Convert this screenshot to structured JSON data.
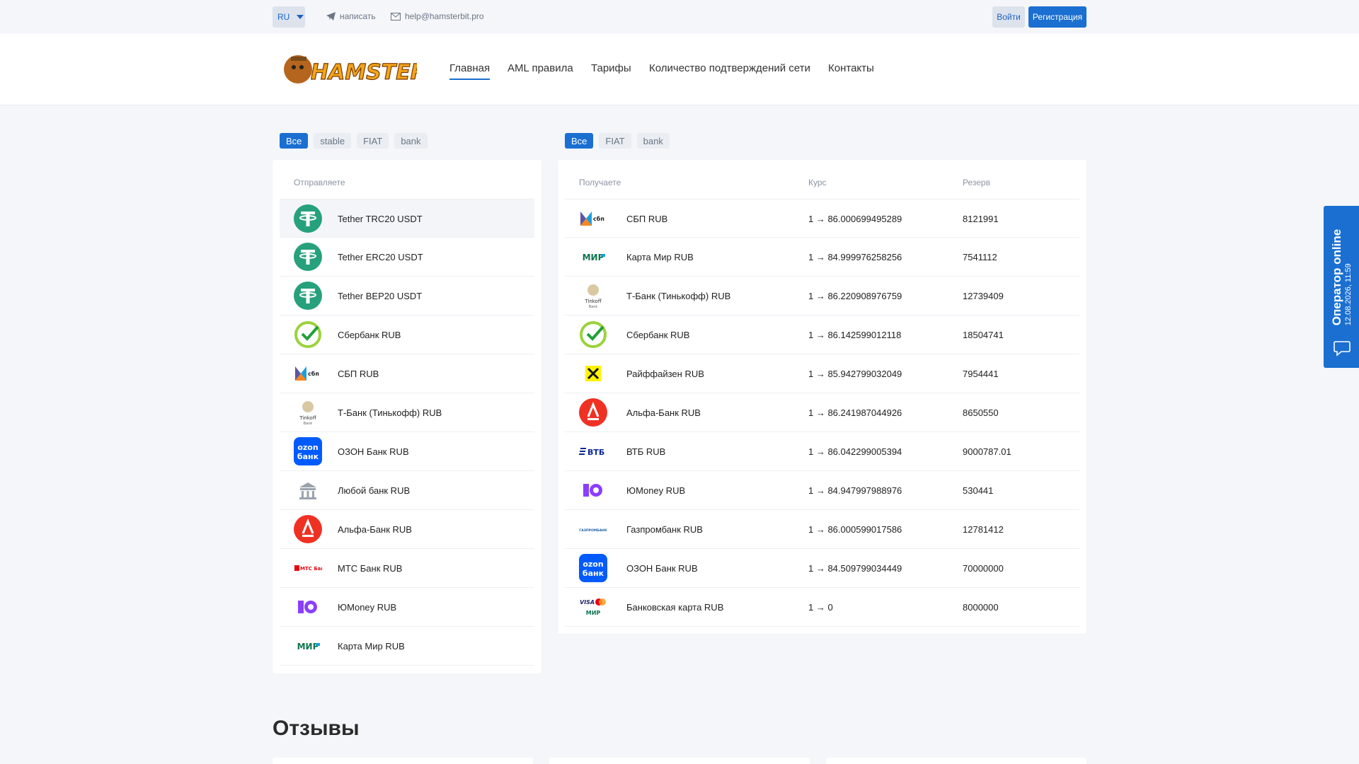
{
  "topbar": {
    "lang": "RU",
    "write_label": "написать",
    "email": "help@hamsterbit.pro",
    "login": "Войти",
    "register": "Регистрация"
  },
  "logo_text": "HAMSTERBIT",
  "nav": [
    "Главная",
    "AML правила",
    "Тарифы",
    "Количество подтверждений сети",
    "Контакты"
  ],
  "send_filters": [
    "Все",
    "stable",
    "FIAT",
    "bank"
  ],
  "receive_filters": [
    "Все",
    "FIAT",
    "bank"
  ],
  "send": {
    "header": "Отправляете",
    "items": [
      {
        "name": "Tether TRC20 USDT",
        "icon": "tether-icon"
      },
      {
        "name": "Tether ERC20 USDT",
        "icon": "tether-icon"
      },
      {
        "name": "Tether BEP20 USDT",
        "icon": "tether-icon"
      },
      {
        "name": "Сбербанк RUB",
        "icon": "sber-icon"
      },
      {
        "name": "СБП RUB",
        "icon": "sbp-icon"
      },
      {
        "name": "Т-Банк (Тинькофф) RUB",
        "icon": "tinkoff-icon"
      },
      {
        "name": "ОЗОН Банк RUB",
        "icon": "ozon-icon"
      },
      {
        "name": "Любой банк RUB",
        "icon": "bank-building-icon"
      },
      {
        "name": "Альфа-Банк RUB",
        "icon": "alfa-icon"
      },
      {
        "name": "МТС Банк RUB",
        "icon": "mts-icon"
      },
      {
        "name": "ЮMoney RUB",
        "icon": "yoomoney-icon"
      },
      {
        "name": "Карта Мир RUB",
        "icon": "mir-icon"
      }
    ]
  },
  "receive": {
    "headers": {
      "name": "Получаете",
      "rate": "Курс",
      "reserve": "Резерв"
    },
    "items": [
      {
        "name": "СБП RUB",
        "rate": "1 → 86.000699495289",
        "reserve": "8121991",
        "icon": "sbp-icon"
      },
      {
        "name": "Карта Мир RUB",
        "rate": "1 → 84.999976258256",
        "reserve": "7541112",
        "icon": "mir-icon"
      },
      {
        "name": "Т-Банк (Тинькофф) RUB",
        "rate": "1 → 86.220908976759",
        "reserve": "12739409",
        "icon": "tinkoff-icon"
      },
      {
        "name": "Сбербанк RUB",
        "rate": "1 → 86.142599012118",
        "reserve": "18504741",
        "icon": "sber-icon"
      },
      {
        "name": "Райффайзен RUB",
        "rate": "1 → 85.942799032049",
        "reserve": "7954441",
        "icon": "raiffeisen-icon"
      },
      {
        "name": "Альфа-Банк RUB",
        "rate": "1 → 86.241987044926",
        "reserve": "8650550",
        "icon": "alfa-icon"
      },
      {
        "name": "ВТБ RUB",
        "rate": "1 → 86.042299005394",
        "reserve": "9000787.01",
        "icon": "vtb-icon"
      },
      {
        "name": "ЮMoney RUB",
        "rate": "1 → 84.947997988976",
        "reserve": "530441",
        "icon": "yoomoney-icon"
      },
      {
        "name": "Газпромбанк RUB",
        "rate": "1 → 86.000599017586",
        "reserve": "12781412",
        "icon": "gazprom-icon"
      },
      {
        "name": "ОЗОН Банк RUB",
        "rate": "1 → 84.509799034449",
        "reserve": "70000000",
        "icon": "ozon-icon"
      },
      {
        "name": "Банковская карта RUB",
        "rate": "1 → 0",
        "reserve": "8000000",
        "icon": "bank-card-icon"
      }
    ]
  },
  "reviews_title": "Отзывы",
  "operator": {
    "title": "Оператор online",
    "time": "12.08.2026, 11:59"
  },
  "icon_text": {
    "sbp": "сбп",
    "mir": "МИР",
    "tinkoff": "Tinkoff",
    "tinkoff_sub": "Bank",
    "ozon_top": "ozon",
    "ozon_bottom": "банк",
    "mts": "МТС Банк",
    "vtb": "ВТБ",
    "gazprom": "ГАЗПРОМБАНК",
    "visa": "VISA"
  },
  "colors": {
    "accent": "#1a6fd1",
    "tether": "#26a17b",
    "alfa": "#ef3124",
    "ozon": "#005bff",
    "yoomoney": "#8b3ffd"
  }
}
